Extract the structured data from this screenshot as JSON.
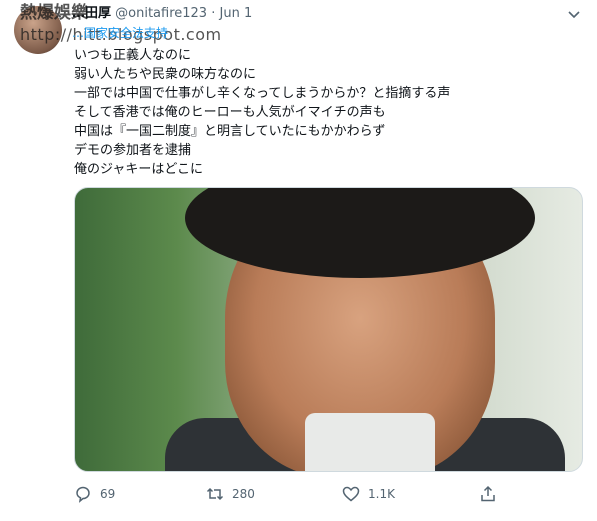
{
  "tweet": {
    "display_name": "…田厚",
    "handle": "@onitafire123",
    "separator": "·",
    "time": "Jun 1",
    "reply_line": "…国家安全法支持",
    "text_lines": [
      "いつも正義人なのに",
      "弱い人たちや民衆の味方なのに",
      "一部では中国で仕事がし辛くなってしまうからか？と指摘する声",
      "そして香港では俺のヒーローも人気がイマイチの声も",
      "中国は『一国二制度』と明言していたにもかかわらず",
      "デモの参加者を逮捕",
      "俺のジャキーはどこに"
    ]
  },
  "watermark": {
    "line1": "熱爆娛樂",
    "line2": "http://hitt.blogspot.com"
  },
  "actions": {
    "reply_count": "69",
    "retweet_count": "280",
    "like_count": "1.1K"
  },
  "icons": {
    "reply": "reply-icon",
    "retweet": "retweet-icon",
    "like": "heart-icon",
    "share": "share-icon",
    "more": "chevron-down-icon"
  },
  "colors": {
    "link": "#1d9bf0",
    "secondary_text": "#536471"
  }
}
